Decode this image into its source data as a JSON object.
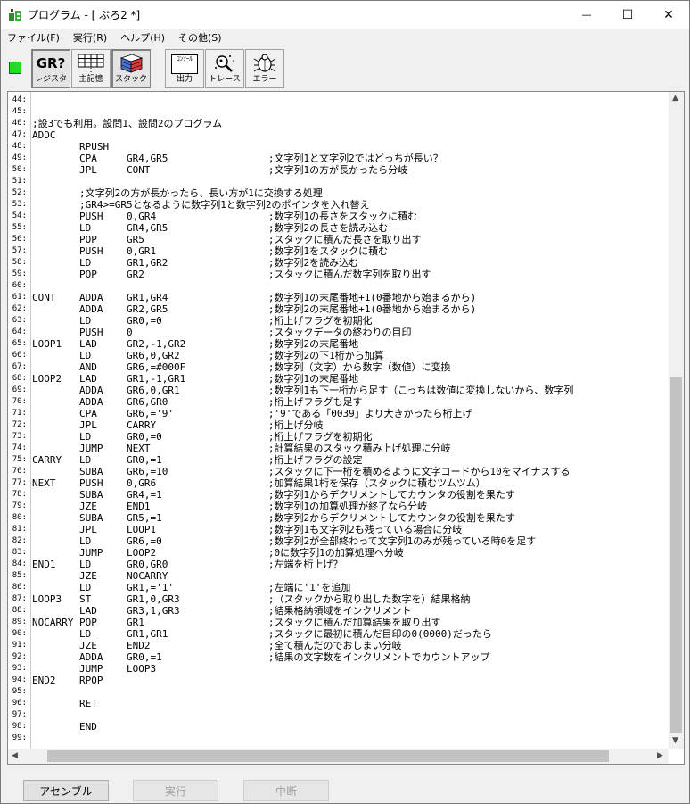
{
  "window": {
    "title": "プログラム - [ ぷろ2 *]",
    "minimize_glyph": "—",
    "maximize_glyph": "☐",
    "close_glyph": "✕"
  },
  "menu": [
    {
      "label": "ファイル(F)"
    },
    {
      "label": "実行(R)"
    },
    {
      "label": "ヘルプ(H)"
    },
    {
      "label": "その他(S)"
    }
  ],
  "toolbar": {
    "indicator_color": "#22dd22",
    "buttons": [
      {
        "label": "レジスタ",
        "icon": "GR?",
        "icon_name": "register-icon",
        "pressed": true
      },
      {
        "label": "主記憶",
        "icon": "",
        "icon_name": "memory-grid-icon",
        "pressed": false
      },
      {
        "label": "スタック",
        "icon": "",
        "icon_name": "stack-cube-icon",
        "pressed": true
      },
      {
        "label": "出力",
        "icon": "ｺﾝｿｰﾙ",
        "icon_name": "console-output-icon",
        "pressed": false
      },
      {
        "label": "トレース",
        "icon": "",
        "icon_name": "trace-magnifier-icon",
        "pressed": false
      },
      {
        "label": "エラー",
        "icon": "",
        "icon_name": "error-bug-icon",
        "pressed": false
      }
    ]
  },
  "editor": {
    "first_line": 44,
    "lines": [
      "",
      "",
      ";設3でも利用。設問1、設問2のプログラム",
      "ADDC",
      "        RPUSH",
      "        CPA     GR4,GR5                 ;文字列1と文字列2ではどっちが長い？",
      "        JPL     CONT                    ;文字列1の方が長かったら分岐",
      "",
      "        ;文字列2の方が長かったら、長い方が1に交換する処理",
      "        ;GR4>=GR5となるように数字列1と数字列2のポインタを入れ替え",
      "        PUSH    0,GR4                   ;数字列1の長さをスタックに積む",
      "        LD      GR4,GR5                 ;数字列2の長さを読み込む",
      "        POP     GR5                     ;スタックに積んだ長さを取り出す",
      "        PUSH    0,GR1                   ;数字列1をスタックに積む",
      "        LD      GR1,GR2                 ;数字列2を読み込む",
      "        POP     GR2                     ;スタックに積んだ数字列を取り出す",
      "",
      "CONT    ADDA    GR1,GR4                 ;数字列1の末尾番地+1(0番地から始まるから)",
      "        ADDA    GR2,GR5                 ;数字列2の末尾番地+1(0番地から始まるから)",
      "        LD      GR0,=0                  ;桁上げフラグを初期化",
      "        PUSH    0                       ;スタックデータの終わりの目印",
      "LOOP1   LAD     GR2,-1,GR2              ;数字列2の末尾番地",
      "        LD      GR6,0,GR2               ;数字列2の下1桁から加算",
      "        AND     GR6,=#000F              ;数字列（文字）から数字（数値）に変換",
      "LOOP2   LAD     GR1,-1,GR1              ;数字列1の末尾番地",
      "        ADDA    GR6,0,GR1               ;数字列1も下一桁から足す（こっちは数値に変換しないから、数字列",
      "        ADDA    GR6,GR0                 ;桁上げフラグも足す",
      "        CPA     GR6,='9'                ;'9'である「0039」より大きかったら桁上げ",
      "        JPL     CARRY                   ;桁上げ分岐",
      "        LD      GR0,=0                  ;桁上げフラグを初期化",
      "        JUMP    NEXT                    ;計算結果のスタック積み上げ処理に分岐",
      "CARRY   LD      GR0,=1                  ;桁上げフラグの設定",
      "        SUBA    GR6,=10                 ;スタックに下一桁を積めるように文字コードから10をマイナスする",
      "NEXT    PUSH    0,GR6                   ;加算結果1桁を保存（スタックに積むツムツム）",
      "        SUBA    GR4,=1                  ;数字列1からデクリメントしてカウンタの役割を果たす",
      "        JZE     END1                    ;数字列1の加算処理が終了なら分岐",
      "        SUBA    GR5,=1                  ;数字列2からデクリメントしてカウンタの役割を果たす",
      "        JPL     LOOP1                   ;数字列1も文字列2も残っている場合に分岐",
      "        LD      GR6,=0                  ;数字列2が全部終わって文字列1のみが残っている時0を足す",
      "        JUMP    LOOP2                   ;0に数字列1の加算処理へ分岐",
      "END1    LD      GR0,GR0                 ;左端を桁上げ？",
      "        JZE     NOCARRY",
      "        LD      GR1,='1'                ;左端に'1'を追加",
      "LOOP3   ST      GR1,0,GR3               ;（スタックから取り出した数字を）結果格納",
      "        LAD     GR3,1,GR3               ;結果格納領域をインクリメント",
      "NOCARRY POP     GR1                     ;スタックに積んだ加算結果を取り出す",
      "        LD      GR1,GR1                 ;スタックに最初に積んだ目印の0(0000)だったら",
      "        JZE     END2                    ;全て積んだのでおしまい分岐",
      "        ADDA    GR0,=1                  ;結果の文字数をインクリメントでカウントアップ",
      "        JUMP    LOOP3",
      "END2    RPOP",
      "",
      "        RET",
      "",
      "        END",
      ""
    ]
  },
  "buttons": {
    "assemble": "アセンブル",
    "run": "実行",
    "stop": "中断"
  }
}
